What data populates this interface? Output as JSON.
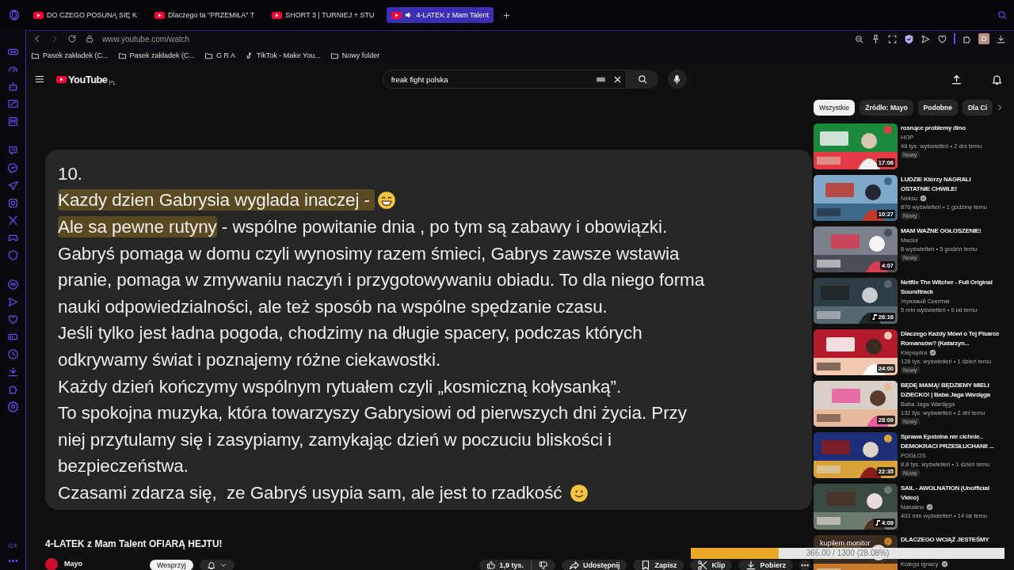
{
  "browser": {
    "tabs": [
      {
        "title": "DO CZEGO POSUNĄ SIĘ K",
        "selected": false,
        "audio": false
      },
      {
        "title": "Dlaczego ta \"PRZEMIŁA\" T",
        "selected": false,
        "audio": false
      },
      {
        "title": "SHORT 3 | TURNIEJ + STU",
        "selected": false,
        "audio": false
      },
      {
        "title": "4-LATEK z Mam Talent",
        "selected": true,
        "audio": true
      }
    ],
    "address": "www.youtube.com/watch",
    "profile_initial": "D",
    "bookmarks": [
      {
        "label": "Pasek zakładek (C...",
        "kind": "folder"
      },
      {
        "label": "Pasek zakładek (C...",
        "kind": "folder"
      },
      {
        "label": "G R A",
        "kind": "folder"
      },
      {
        "label": "TikTok - Make You...",
        "kind": "site"
      },
      {
        "label": "Nowy folder",
        "kind": "folder"
      }
    ],
    "sidebar_footer": "GX"
  },
  "youtube": {
    "logo": "YouTube",
    "region": "PL",
    "search": {
      "value": "freak fight polska"
    },
    "video_frame": {
      "lines": [
        {
          "kind": "text",
          "segments": [
            {
              "text": "10.",
              "highlight": false
            }
          ]
        },
        {
          "kind": "grin",
          "segments": [
            {
              "text": "Kazdy dzien Gabrysia wyglada inaczej - ",
              "highlight": true
            }
          ]
        },
        {
          "kind": "text",
          "segments": [
            {
              "text": "Ale sa pewne rutyny",
              "highlight": true
            },
            {
              "text": " - wspólne powitanie dnia , po tym są zabawy i obowiązki.",
              "highlight": false
            }
          ]
        },
        {
          "kind": "text",
          "segments": [
            {
              "text": "Gabryś pomaga w domu czyli wynosimy razem śmieci, Gabrys zawsze wstawia",
              "highlight": false
            }
          ]
        },
        {
          "kind": "text",
          "segments": [
            {
              "text": "pranie, pomaga w zmywaniu naczyń i przygotowywaniu obiadu. To dla niego forma",
              "highlight": false
            }
          ]
        },
        {
          "kind": "text",
          "segments": [
            {
              "text": "nauki odpowiedzialności, ale też sposób na wspólne spędzanie czasu.",
              "highlight": false
            }
          ]
        },
        {
          "kind": "text",
          "segments": [
            {
              "text": "Jeśli tylko jest ładna pogoda, chodzimy na długie spacery, podczas których",
              "highlight": false
            }
          ]
        },
        {
          "kind": "text",
          "segments": [
            {
              "text": "odkrywamy świat i poznajemy różne ciekawostki.",
              "highlight": false
            }
          ]
        },
        {
          "kind": "text",
          "segments": [
            {
              "text": "Każdy dzień kończymy wspólnym rytuałem czyli „kosmiczną kołysanką”.",
              "highlight": false
            }
          ]
        },
        {
          "kind": "text",
          "segments": [
            {
              "text": "To spokojna muzyka, która towarzyszy Gabrysiowi od pierwszych dni życia. Przy",
              "highlight": false
            }
          ]
        },
        {
          "kind": "text",
          "segments": [
            {
              "text": "niej przytulamy się i zasypiamy, zamykając dzień w poczuciu bliskości i",
              "highlight": false
            }
          ]
        },
        {
          "kind": "text",
          "segments": [
            {
              "text": "bezpieczeństwa.",
              "highlight": false
            }
          ]
        },
        {
          "kind": "smile",
          "segments": [
            {
              "text": "Czasami zdarza się,  ze Gabryś usypia sam, ale jest to rzadkość ",
              "highlight": false
            }
          ]
        }
      ]
    },
    "video": {
      "title": "4-LATEK z Mam Talent OFIARĄ HEJTU!",
      "channel": "Mayo",
      "support_button": "Wesprzyj",
      "likes": "1,9 tys.",
      "actions": [
        {
          "label": "Udostępnij",
          "kind": "share"
        },
        {
          "label": "Zapisz",
          "kind": "save"
        },
        {
          "label": "Klip",
          "kind": "clip"
        },
        {
          "label": "Pobierz",
          "kind": "download"
        }
      ]
    },
    "chips": [
      {
        "label": "Wszystkie",
        "selected": true
      },
      {
        "label": "Źródło: Mayo",
        "selected": false
      },
      {
        "label": "Podobne",
        "selected": false
      },
      {
        "label": "Dla Ci",
        "selected": false
      }
    ],
    "recommendations": [
      {
        "title": "rosnące problemy dino",
        "channel": "HOP",
        "verified": false,
        "meta": "48 tys. wyświetleń • 2 dni temu",
        "badge": "Nowy",
        "duration": "17:06",
        "music": false
      },
      {
        "title": "LUDZIE Którzy NAGRALI OSTATNIE CHWILE!",
        "channel": "Neksu",
        "verified": true,
        "meta": "876 wyświetleń • 1 godzinę temu",
        "badge": "Nowy",
        "duration": "10:27",
        "music": false
      },
      {
        "title": "MAM WAŻNE OGŁOSZENIE!",
        "channel": "Maciol",
        "verified": false,
        "meta": "8 wyświetleń • 5 godzin temu",
        "badge": "Nowy",
        "duration": "4:07",
        "music": false
      },
      {
        "title": "Netflix The Witcher - Full Original Soundtrack",
        "channel": "Угрюмый Скептик",
        "verified": false,
        "meta": "5 mln wyświetleń • 6 lat temu",
        "duration": "26:16",
        "music": true
      },
      {
        "title": "Dlaczego Każdy Mówi o Tej Pisarce Romansów? (Katarzyn...",
        "channel": "Klepsydra",
        "verified": true,
        "meta": "128 tys. wyświetleń • 1 dzień temu",
        "badge": "Nowy",
        "duration": "24:00",
        "music": false
      },
      {
        "title": "BĘDĘ MAMĄ! BĘDZIEMY MIELI DZIECKO! | Baba Jaga Wardęga",
        "channel": "Baba Jaga Wardęga",
        "verified": false,
        "meta": "132 tys. wyświetleń • 2 dni temu",
        "badge": "Nowy",
        "duration": "28:09",
        "music": false
      },
      {
        "title": "Sprawa Epsteina nie cichnie.. DEMOKRACI PRZESŁUCHANI! ...",
        "channel": "POGŁOS",
        "verified": false,
        "meta": "8,8 tys. wyświetleń • 1 dzień temu",
        "badge": "Nowy",
        "duration": "22:35",
        "music": false
      },
      {
        "title": "SAIL - AWOLNATION (Unofficial Video)",
        "channel": "Nanalew",
        "verified": true,
        "meta": "403 mln wyświetleń • 14 lat temu",
        "duration": "4:09",
        "music": true
      },
      {
        "title": "DLACZEGO WCIĄŻ JESTEŚMY",
        "channel": "Kolega Ignacy",
        "verified": true
      }
    ]
  },
  "goal_overlay": {
    "title": "kupiłem monitor",
    "progress": "365.00 / 1300 (28.08%)",
    "level": 0.28
  }
}
